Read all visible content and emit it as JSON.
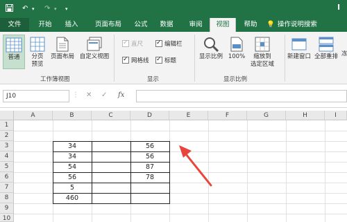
{
  "window": {
    "title": "I"
  },
  "tabs": {
    "file": "文件",
    "home": "开始",
    "insert": "插入",
    "page_layout": "页面布局",
    "formulas": "公式",
    "data": "数据",
    "review": "审阅",
    "view": "视图",
    "help": "帮助",
    "tell_me": "操作说明搜索"
  },
  "ribbon": {
    "workbook_views": {
      "normal": "普通",
      "page_break_line1": "分页",
      "page_break_line2": "预览",
      "page_layout": "页面布局",
      "custom_views": "自定义视图",
      "label": "工作簿视图"
    },
    "show": {
      "ruler": {
        "label": "直尺",
        "checked": true,
        "enabled": false
      },
      "formula_bar": {
        "label": "编辑栏",
        "checked": true,
        "enabled": true
      },
      "gridlines": {
        "label": "网格线",
        "checked": true,
        "enabled": true
      },
      "headings": {
        "label": "标题",
        "checked": true,
        "enabled": true
      },
      "label": "显示"
    },
    "zoom": {
      "zoom": "显示比例",
      "zoom_100": "100%",
      "zoom_selection_line1": "缩放到",
      "zoom_selection_line2": "选定区域",
      "label": "显示比例"
    },
    "window": {
      "new_window": "新建窗口",
      "arrange_all": "全部重排",
      "freeze": "冻"
    }
  },
  "formula_bar": {
    "name_box": "J10",
    "cancel": "✕",
    "enter": "✓",
    "fx": "fx",
    "value": ""
  },
  "sheet": {
    "columns": [
      "A",
      "B",
      "C",
      "D",
      "E",
      "F",
      "G",
      "H",
      "I"
    ],
    "rows": [
      "1",
      "2",
      "3",
      "4",
      "5",
      "6",
      "7",
      "8",
      "9",
      "10"
    ],
    "cells": {
      "B3": "34",
      "B4": "34",
      "B5": "54",
      "B6": "56",
      "B7": "5",
      "B8": "460",
      "D3": "56",
      "D4": "56",
      "D5": "87",
      "D6": "78"
    }
  },
  "colors": {
    "brand": "#217346",
    "arrow": "#e8463c"
  }
}
